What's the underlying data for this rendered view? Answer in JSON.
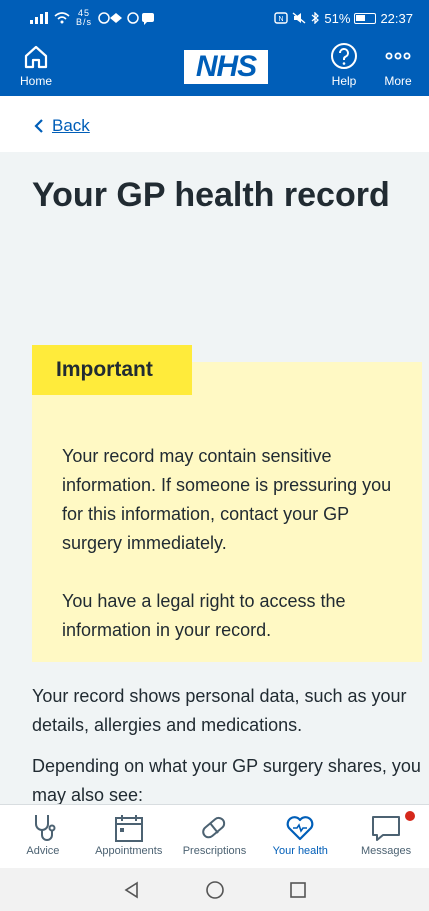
{
  "status_bar": {
    "signal": "…≡",
    "speed_top": "45",
    "speed_unit": "B/s",
    "battery": "51%",
    "time": "22:37"
  },
  "header": {
    "home_label": "Home",
    "logo": "NHS",
    "help_label": "Help",
    "more_label": "More"
  },
  "back_link": {
    "label": "Back"
  },
  "page": {
    "title": "Your GP health record",
    "callout": {
      "label": "Important",
      "paragraphs": [
        "Your record may contain sensitive information. If someone is pressuring you for this information, contact your GP surgery immediately.",
        "You have a legal right to access the information in your record."
      ]
    },
    "body": [
      "Your record shows personal data, such as your details, allergies and medications.",
      "Depending on what your GP surgery shares, you may also see:"
    ]
  },
  "tabs": [
    {
      "label": "Advice",
      "icon": "stethoscope-icon"
    },
    {
      "label": "Appointments",
      "icon": "calendar-icon"
    },
    {
      "label": "Prescriptions",
      "icon": "pill-icon"
    },
    {
      "label": "Your health",
      "icon": "heart-icon",
      "active": true
    },
    {
      "label": "Messages",
      "icon": "message-icon",
      "badge": true
    }
  ],
  "colors": {
    "header": "#005eb8",
    "callout_bg": "#fff9c4",
    "callout_label": "#ffeb3b",
    "active_tab": "#005eb8",
    "badge": "#d5281b"
  }
}
